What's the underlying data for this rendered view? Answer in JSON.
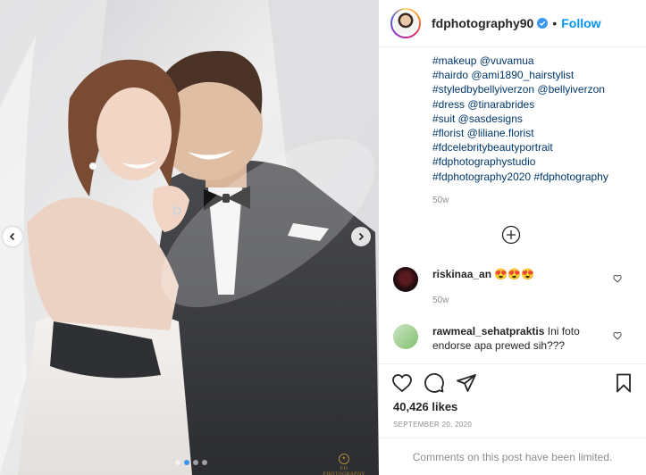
{
  "post": {
    "image": {
      "slide_count": 4,
      "active_slide": 1,
      "watermark": "FD PHOTOGRAPHY"
    },
    "header": {
      "username": "fdphotography90",
      "separator": "•",
      "follow_label": "Follow",
      "verified": true
    },
    "caption": {
      "lines": [
        "#makeup @vuvamua",
        "#hairdo @ami1890_hairstylist",
        "#styledbybellyiverzon @bellyiverzon",
        "#dress @tinarabrides",
        "#suit @sasdesigns",
        "#florist @liliane.florist",
        "#fdcelebritybeautyportrait",
        "#fdphotographystudio",
        "#fdphotography2020 #fdphotography"
      ],
      "time": "50w"
    },
    "comments": [
      {
        "username": "riskinaa_an",
        "text": "😍😍😍",
        "time": "50w"
      },
      {
        "username": "rawmeal_sehatpraktis",
        "text": "Ini foto endorse apa prewed sih???",
        "time": ""
      }
    ],
    "likes": "40,426 likes",
    "date": "SEPTEMBER 20, 2020",
    "footer": "Comments on this post have been limited."
  },
  "colors": {
    "link": "#00376b",
    "accent": "#0095f6",
    "muted": "#8e8e8e",
    "dot_active": "#3897f0"
  },
  "icons": [
    "chevron-left-icon",
    "chevron-right-icon",
    "verified-badge-icon",
    "plus-circle-icon",
    "heart-icon",
    "comment-icon",
    "share-icon",
    "bookmark-icon"
  ]
}
